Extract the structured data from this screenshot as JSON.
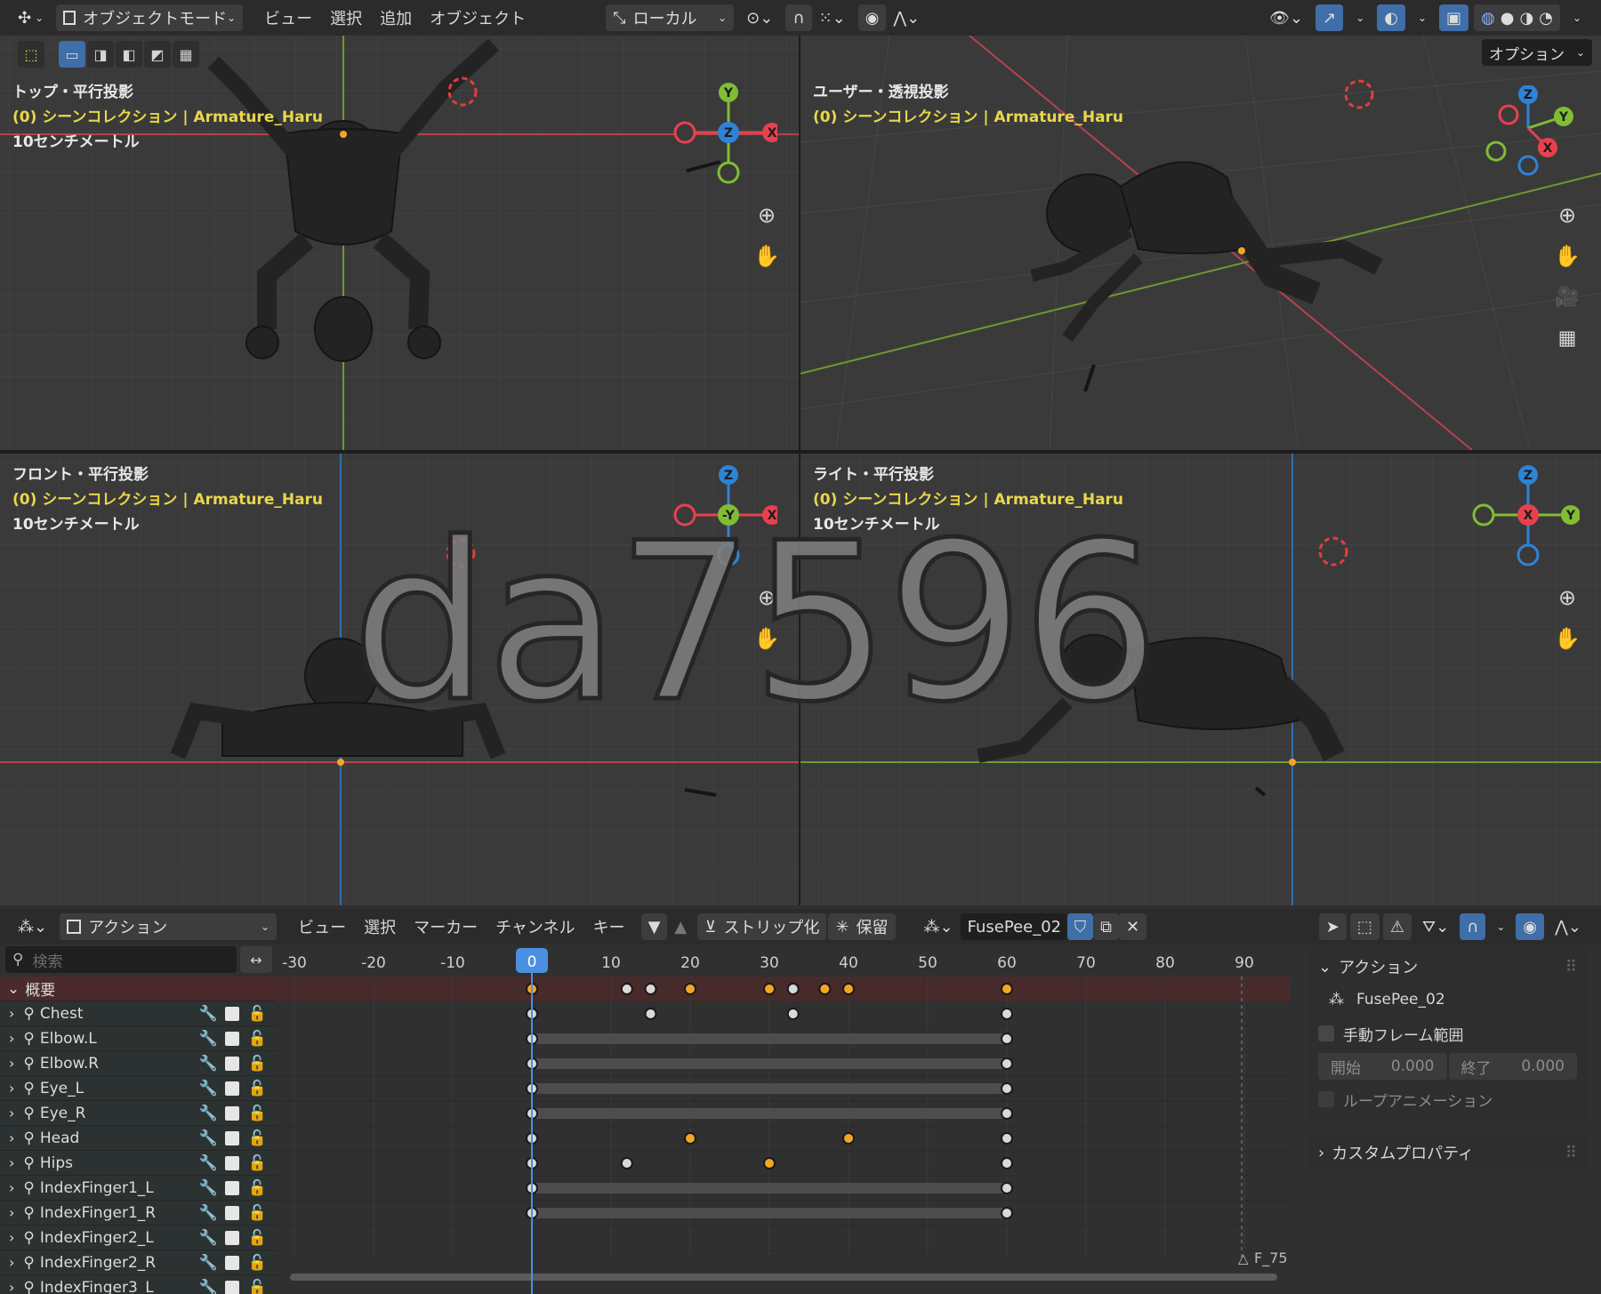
{
  "header3d": {
    "mode": "オブジェクトモード",
    "menus": [
      "ビュー",
      "選択",
      "追加",
      "オブジェクト"
    ],
    "transform_space": "ローカル",
    "options": "オプション"
  },
  "viewports": [
    {
      "view": "トップ・平行投影",
      "collection": "(0) シーンコレクション | Armature_Haru",
      "scale": "10センチメートル",
      "gizmo": [
        "Y",
        "Z",
        "X"
      ]
    },
    {
      "view": "ユーザー・透視投影",
      "collection": "(0) シーンコレクション | Armature_Haru",
      "scale": "",
      "gizmo": [
        "Z",
        "Y",
        "X"
      ]
    },
    {
      "view": "フロント・平行投影",
      "collection": "(0) シーンコレクション | Armature_Haru",
      "scale": "10センチメートル",
      "gizmo": [
        "Z",
        "-Y",
        "X"
      ]
    },
    {
      "view": "ライト・平行投影",
      "collection": "(0) シーンコレクション | Armature_Haru",
      "scale": "10センチメートル",
      "gizmo": [
        "Z",
        "X",
        "Y"
      ]
    }
  ],
  "dopesheet": {
    "mode": "アクション",
    "menus": [
      "ビュー",
      "選択",
      "マーカー",
      "チャンネル",
      "キー"
    ],
    "strip_button": "ストリップ化",
    "stash_button": "保留",
    "action_name": "FusePee_02",
    "search_placeholder": "検索",
    "frame_ticks": [
      "-30",
      "-20",
      "-10",
      "0",
      "10",
      "20",
      "30",
      "40",
      "50",
      "60",
      "70",
      "80",
      "90"
    ],
    "current_frame": "0",
    "summary_label": "概要",
    "channels": [
      "Chest",
      "Elbow.L",
      "Elbow.R",
      "Eye_L",
      "Eye_R",
      "Head",
      "Hips",
      "IndexFinger1_L",
      "IndexFinger1_R",
      "IndexFinger2_L",
      "IndexFinger2_R",
      "IndexFinger3_L"
    ],
    "marker": "F_75",
    "keyframes": {
      "summary": [
        {
          "f": 0,
          "c": "o"
        },
        {
          "f": 12,
          "c": "w"
        },
        {
          "f": 15,
          "c": "w"
        },
        {
          "f": 20,
          "c": "o"
        },
        {
          "f": 30,
          "c": "o"
        },
        {
          "f": 33,
          "c": "w"
        },
        {
          "f": 37,
          "c": "o"
        },
        {
          "f": 40,
          "c": "o"
        },
        {
          "f": 60,
          "c": "o"
        }
      ],
      "Chest": [
        {
          "f": 0,
          "c": "w"
        },
        {
          "f": 15,
          "c": "w"
        },
        {
          "f": 33,
          "c": "w"
        },
        {
          "f": 60,
          "c": "w"
        }
      ],
      "Elbow.L": [
        {
          "f": 0,
          "c": "w"
        },
        {
          "f": 60,
          "c": "w"
        }
      ],
      "Elbow.R": [
        {
          "f": 0,
          "c": "w"
        },
        {
          "f": 60,
          "c": "w"
        }
      ],
      "Eye_L": [
        {
          "f": 0,
          "c": "w"
        },
        {
          "f": 60,
          "c": "w"
        }
      ],
      "Eye_R": [
        {
          "f": 0,
          "c": "w"
        },
        {
          "f": 60,
          "c": "w"
        }
      ],
      "Head": [
        {
          "f": 0,
          "c": "w"
        },
        {
          "f": 20,
          "c": "o"
        },
        {
          "f": 40,
          "c": "o"
        },
        {
          "f": 60,
          "c": "w"
        }
      ],
      "Hips": [
        {
          "f": 0,
          "c": "w"
        },
        {
          "f": 12,
          "c": "w"
        },
        {
          "f": 30,
          "c": "o"
        },
        {
          "f": 60,
          "c": "w"
        }
      ],
      "IndexFinger1_L": [
        {
          "f": 0,
          "c": "w"
        },
        {
          "f": 60,
          "c": "w"
        }
      ],
      "IndexFinger1_R": [
        {
          "f": 0,
          "c": "w"
        },
        {
          "f": 60,
          "c": "w"
        }
      ]
    },
    "hold_channels": [
      "Elbow.L",
      "Elbow.R",
      "Eye_L",
      "Eye_R",
      "IndexFinger1_L",
      "IndexFinger1_R"
    ]
  },
  "sidepanel": {
    "action_header": "アクション",
    "action_name": "FusePee_02",
    "manual_range": "手動フレーム範囲",
    "start_label": "開始",
    "start_value": "0.000",
    "end_label": "終了",
    "end_value": "0.000",
    "loop": "ループアニメーション",
    "custom_props": "カスタムプロパティ"
  },
  "watermark": "da7596",
  "colors": {
    "axis_x": "#e8414e",
    "axis_y": "#80bd33",
    "axis_z": "#2f83d6",
    "key_selected": "#f4a623",
    "key_normal": "#d9d9d9",
    "playhead": "#4a90e2",
    "overlay_yellow": "#e9d74a"
  }
}
